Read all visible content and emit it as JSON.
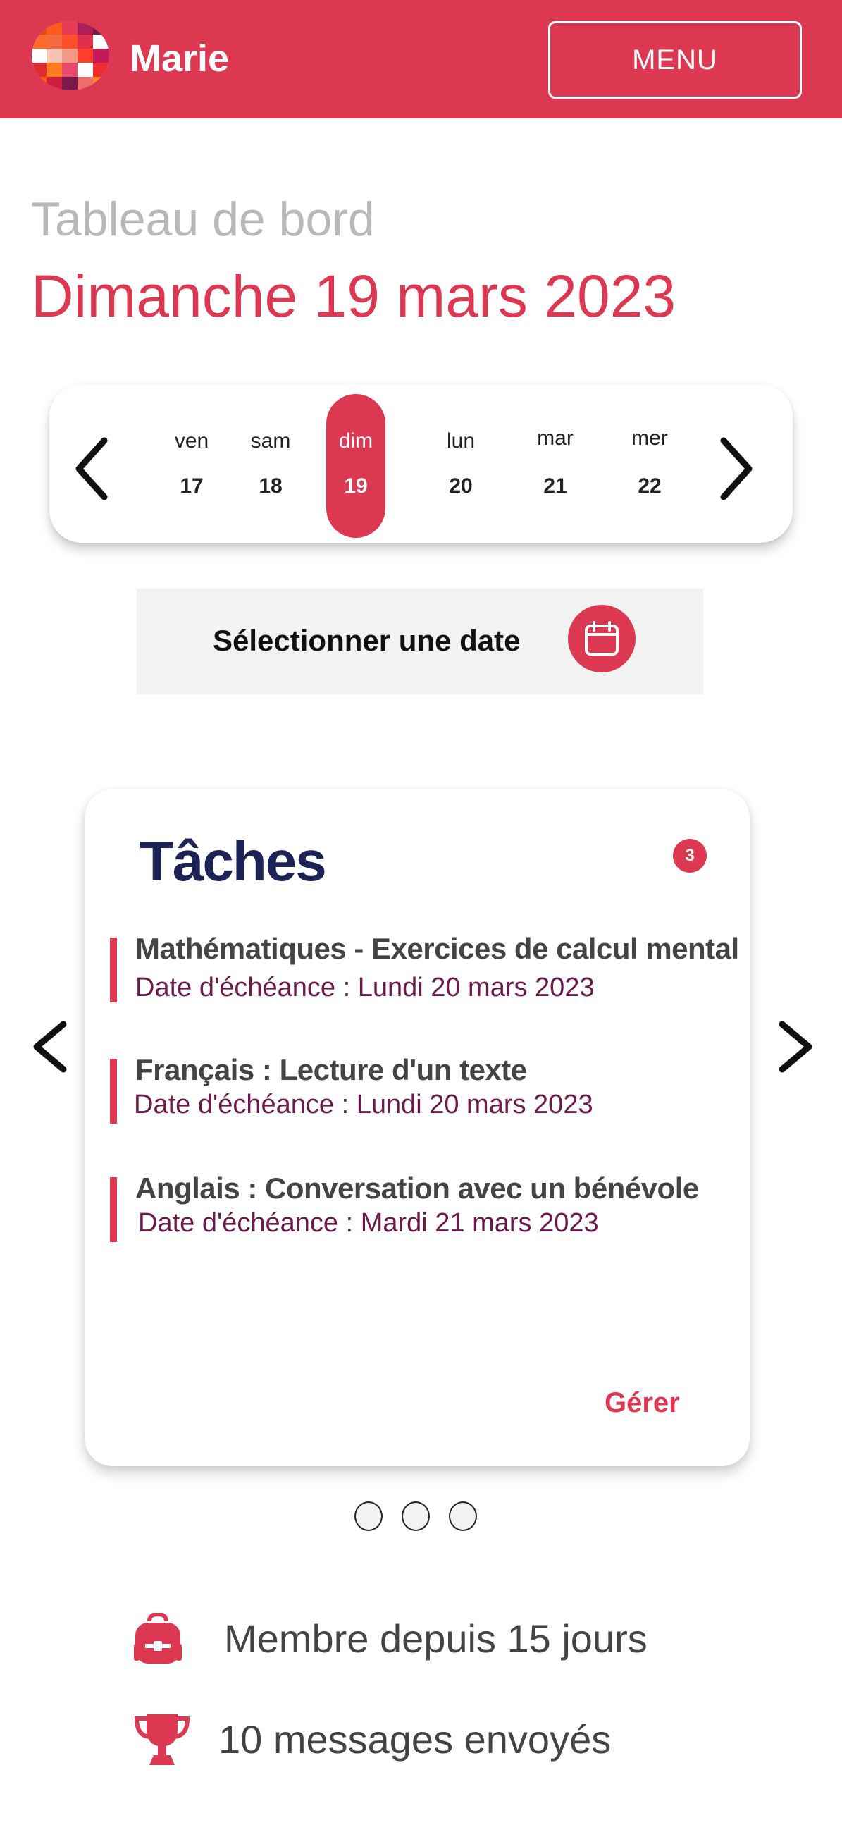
{
  "header": {
    "user_name": "Marie",
    "menu_label": "MENU",
    "brand_color": "#dc3852"
  },
  "dashboard": {
    "subtitle": "Tableau de bord",
    "title": "Dimanche 19 mars 2023"
  },
  "date_strip": {
    "days": [
      {
        "name": "ven",
        "date": "17"
      },
      {
        "name": "sam",
        "date": "18"
      },
      {
        "name": "dim",
        "date": "19",
        "selected": true
      },
      {
        "name": "lun",
        "date": "20"
      },
      {
        "name": "mar",
        "date": "21"
      },
      {
        "name": "mer",
        "date": "22"
      }
    ],
    "prev_icon": "chevron-left-icon",
    "next_icon": "chevron-right-icon"
  },
  "select_date": {
    "label": "Sélectionner une date",
    "icon": "calendar-icon"
  },
  "tasks": {
    "title": "Tâches",
    "count": "3",
    "items": [
      {
        "name": "Mathématiques - Exercices de calcul mental",
        "due": "Date d'échéance : Lundi 20 mars 2023"
      },
      {
        "name": "Français : Lecture d'un texte",
        "due": "Date d'échéance : Lundi 20 mars 2023"
      },
      {
        "name": "Anglais : Conversation avec un bénévole",
        "due": "Date d'échéance : Mardi 21 mars 2023"
      }
    ],
    "manage_label": "Gérer"
  },
  "carousel": {
    "page_count": 3
  },
  "stats": {
    "member_since": "Membre depuis 15 jours",
    "messages_sent": "10 messages envoyés",
    "member_icon": "backpack-icon",
    "messages_icon": "trophy-icon"
  }
}
